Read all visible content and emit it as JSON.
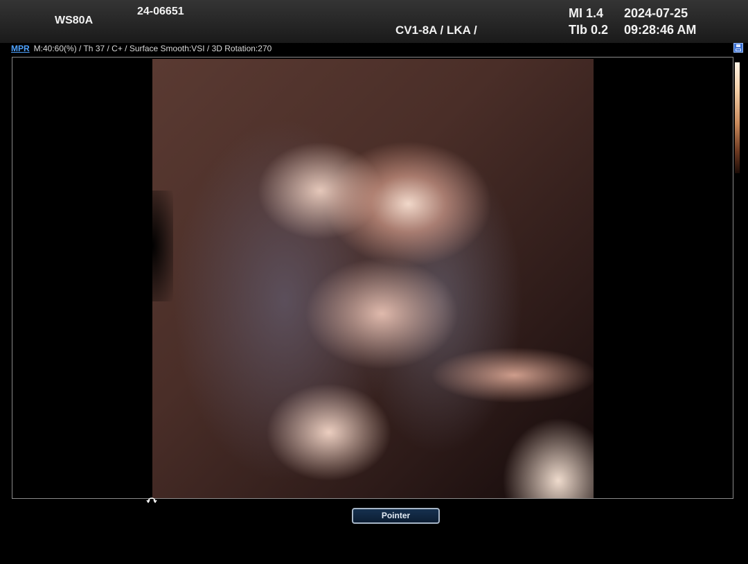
{
  "header": {
    "model": "WS80A",
    "patient_id": "24-06651",
    "probe": "CV1-8A / LKA /",
    "mi": "MI  1.4",
    "tib": "TIb 0.2",
    "date": "2024-07-25",
    "time": "09:28:46 AM"
  },
  "params": {
    "mode_link": "MPR",
    "settings": "M:40:60(%) / Th 37 / C+ / Surface Smooth:VSI / 3D Rotation:270"
  },
  "icons": {
    "save": "save-icon",
    "rotate": "rotate-icon"
  },
  "controls": {
    "pointer_label": "Pointer"
  },
  "colors": {
    "mode_link": "#4ea2ff",
    "render_tint": "#5a3a32"
  }
}
